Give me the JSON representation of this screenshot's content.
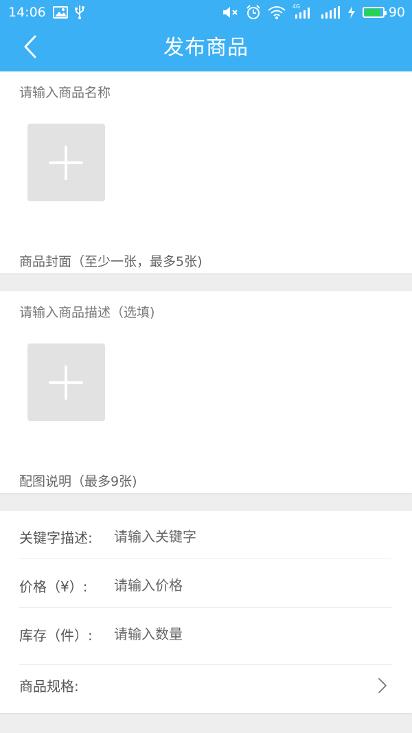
{
  "status_bar": {
    "time": "14:06",
    "battery": "90",
    "battery_level": 0.9,
    "network_badge": "4G",
    "icons": [
      "image-icon",
      "usb-icon",
      "mute-icon",
      "alarm-icon",
      "wifi-icon",
      "signal-icon",
      "signal-icon",
      "charging-icon",
      "battery-icon"
    ]
  },
  "header": {
    "back_icon": "chevron-left-icon",
    "title": "发布商品"
  },
  "name_section": {
    "name_placeholder": "请输入商品名称",
    "add_icon": "plus-icon",
    "cover_hint": "商品封面（至少一张，最多5张)"
  },
  "desc_section": {
    "desc_placeholder": "请输入商品描述（选填)",
    "add_icon": "plus-icon",
    "image_hint": "配图说明（最多9张)"
  },
  "form": {
    "keyword_label": "关键字描述:",
    "keyword_placeholder": "请输入关键字",
    "price_label": "价格（¥）:",
    "price_placeholder": "请输入价格",
    "stock_label": "库存（件）:",
    "stock_placeholder": "请输入数量",
    "spec_label": "商品规格:",
    "spec_icon": "chevron-right-icon"
  },
  "colors": {
    "primary": "#3bb0f5",
    "battery": "#27d34b",
    "background": "#eeeeee",
    "tile": "#e2e2e2"
  }
}
